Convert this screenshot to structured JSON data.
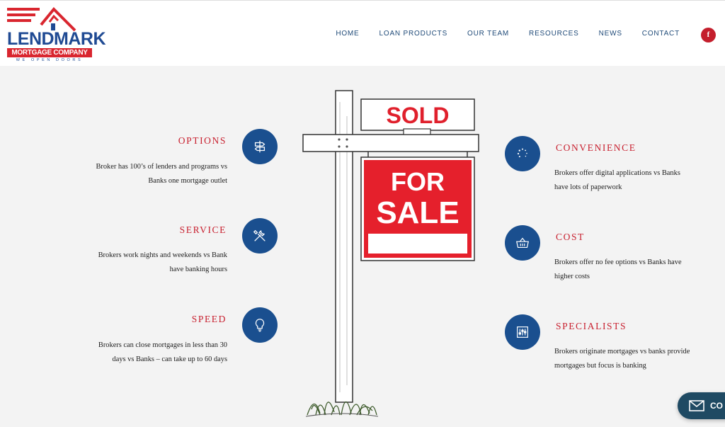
{
  "logo": {
    "brand": "LENDMARK",
    "company": "MORTGAGE COMPANY",
    "tagline": "WE OPEN DOORS"
  },
  "nav": {
    "items": [
      "HOME",
      "LOAN PRODUCTS",
      "OUR TEAM",
      "RESOURCES",
      "NEWS",
      "CONTACT"
    ]
  },
  "social": {
    "facebook_glyph": "f"
  },
  "features": {
    "options": {
      "title": "OPTIONS",
      "text": "Broker has 100’s of lenders and programs vs Banks one mortgage outlet",
      "icon": "signpost-icon"
    },
    "service": {
      "title": "SERVICE",
      "text": "Brokers work nights and weekends vs Bank have banking hours",
      "icon": "tools-icon"
    },
    "speed": {
      "title": "SPEED",
      "text": "Brokers can close mortgages in less than 30 days vs Banks – can take up to 60 days",
      "icon": "lightbulb-icon"
    },
    "convenience": {
      "title": "CONVENIENCE",
      "text": "Brokers offer digital applications vs Banks have lots of paperwork",
      "icon": "spinner-icon"
    },
    "cost": {
      "title": "COST",
      "text": "Brokers offer no fee options vs Banks have higher costs",
      "icon": "basket-icon"
    },
    "specialists": {
      "title": "SPECIALISTS",
      "text": "Brokers originate mortgages vs banks provide mortgages but focus is banking",
      "icon": "sliders-icon"
    }
  },
  "sign": {
    "top": "SOLD",
    "line1": "FOR",
    "line2": "SALE"
  },
  "contact_widget": {
    "label": "CO"
  },
  "colors": {
    "accent_red": "#c8202f",
    "navy": "#1a4f8f",
    "nav_text": "#1f4a78"
  }
}
